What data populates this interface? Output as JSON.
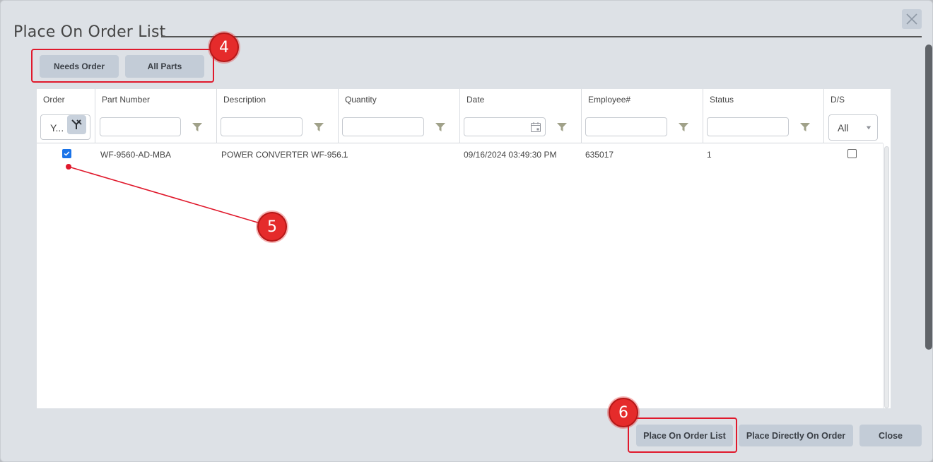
{
  "dialog": {
    "title": "Place On Order List"
  },
  "filters": {
    "needs_order_label": "Needs Order",
    "all_parts_label": "All Parts"
  },
  "grid": {
    "columns": [
      "Order",
      "Part Number",
      "Description",
      "Quantity",
      "Date",
      "Employee#",
      "Status",
      "D/S"
    ],
    "order_filter_value": "Y...",
    "ds_filter_value": "All",
    "rows": [
      {
        "order_checked": true,
        "part_number": "WF-9560-AD-MBA",
        "description": "POWER CONVERTER WF-956...",
        "quantity": "1",
        "date": "09/16/2024 03:49:30 PM",
        "employee": "635017",
        "status": "1",
        "ds_checked": false
      }
    ]
  },
  "footer": {
    "place_on_order_list_label": "Place On Order List",
    "place_directly_label": "Place Directly On Order",
    "close_label": "Close"
  },
  "annotations": {
    "badge4": "4",
    "badge5": "5",
    "badge6": "6"
  },
  "colors": {
    "annotation_red": "#e52b2b",
    "button_bg": "#c3ccd7",
    "dialog_bg": "#dde1e6",
    "checkbox_blue": "#1a73e8"
  },
  "icons": [
    "close-icon",
    "funnel-icon",
    "clear-filter-icon",
    "calendar-icon",
    "dropdown-caret-icon"
  ]
}
